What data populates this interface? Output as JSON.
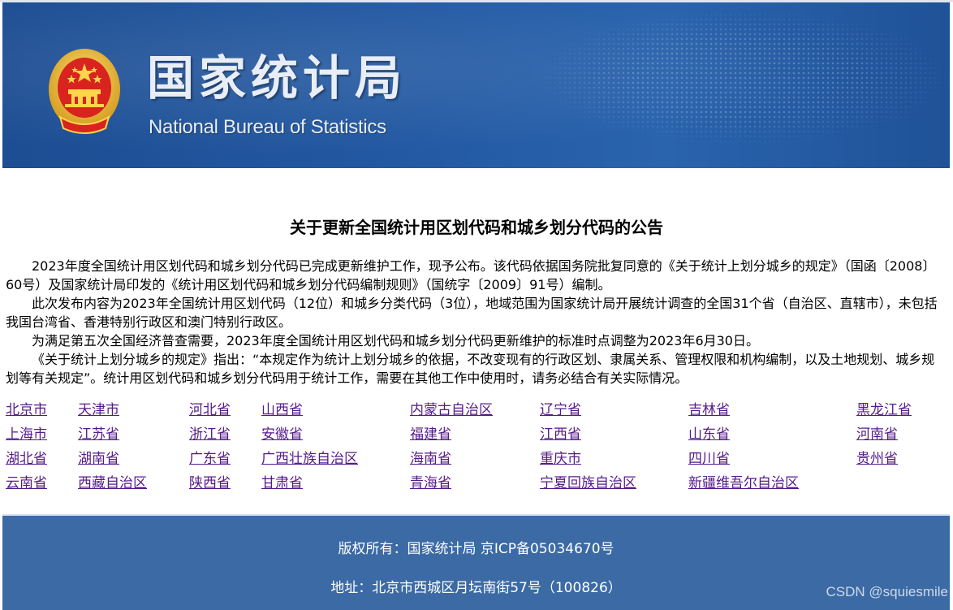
{
  "header": {
    "title_cn": "国家统计局",
    "title_en": "National Bureau of Statistics"
  },
  "announcement": {
    "title": "关于更新全国统计用区划代码和城乡划分代码的公告",
    "paragraphs": [
      "2023年度全国统计用区划代码和城乡划分代码已完成更新维护工作，现予公布。该代码依据国务院批复同意的《关于统计上划分城乡的规定》（国函〔2008〕60号）及国家统计局印发的《统计用区划代码和城乡划分代码编制规则》（国统字〔2009〕91号）编制。",
      "此次发布内容为2023年全国统计用区划代码（12位）和城乡分类代码（3位），地域范围为国家统计局开展统计调查的全国31个省（自治区、直辖市），未包括我国台湾省、香港特别行政区和澳门特别行政区。",
      "为满足第五次全国经济普查需要，2023年度全国统计用区划代码和城乡划分代码更新维护的标准时点调整为2023年6月30日。",
      "《关于统计上划分城乡的规定》指出：“本规定作为统计上划分城乡的依据，不改变现有的行政区划、隶属关系、管理权限和机构编制，以及土地规划、城乡规划等有关规定”。统计用区划代码和城乡划分代码用于统计工作，需要在其他工作中使用时，请务必结合有关实际情况。"
    ]
  },
  "provinces": [
    [
      "北京市",
      "天津市",
      "河北省",
      "山西省",
      "内蒙古自治区",
      "辽宁省",
      "吉林省",
      "黑龙江省"
    ],
    [
      "上海市",
      "江苏省",
      "浙江省",
      "安徽省",
      "福建省",
      "江西省",
      "山东省",
      "河南省"
    ],
    [
      "湖北省",
      "湖南省",
      "广东省",
      "广西壮族自治区",
      "海南省",
      "重庆市",
      "四川省",
      "贵州省"
    ],
    [
      "云南省",
      "西藏自治区",
      "陕西省",
      "甘肃省",
      "青海省",
      "宁夏回族自治区",
      "新疆维吾尔自治区",
      ""
    ]
  ],
  "footer": {
    "copyright": "版权所有：国家统计局 京ICP备05034670号",
    "address": "地址：北京市西城区月坛南街57号（100826）"
  },
  "watermark": "CSDN @squiesmile",
  "colors": {
    "banner": "#235aa3",
    "footer": "#3b6aa5",
    "link": "#551a8b"
  }
}
